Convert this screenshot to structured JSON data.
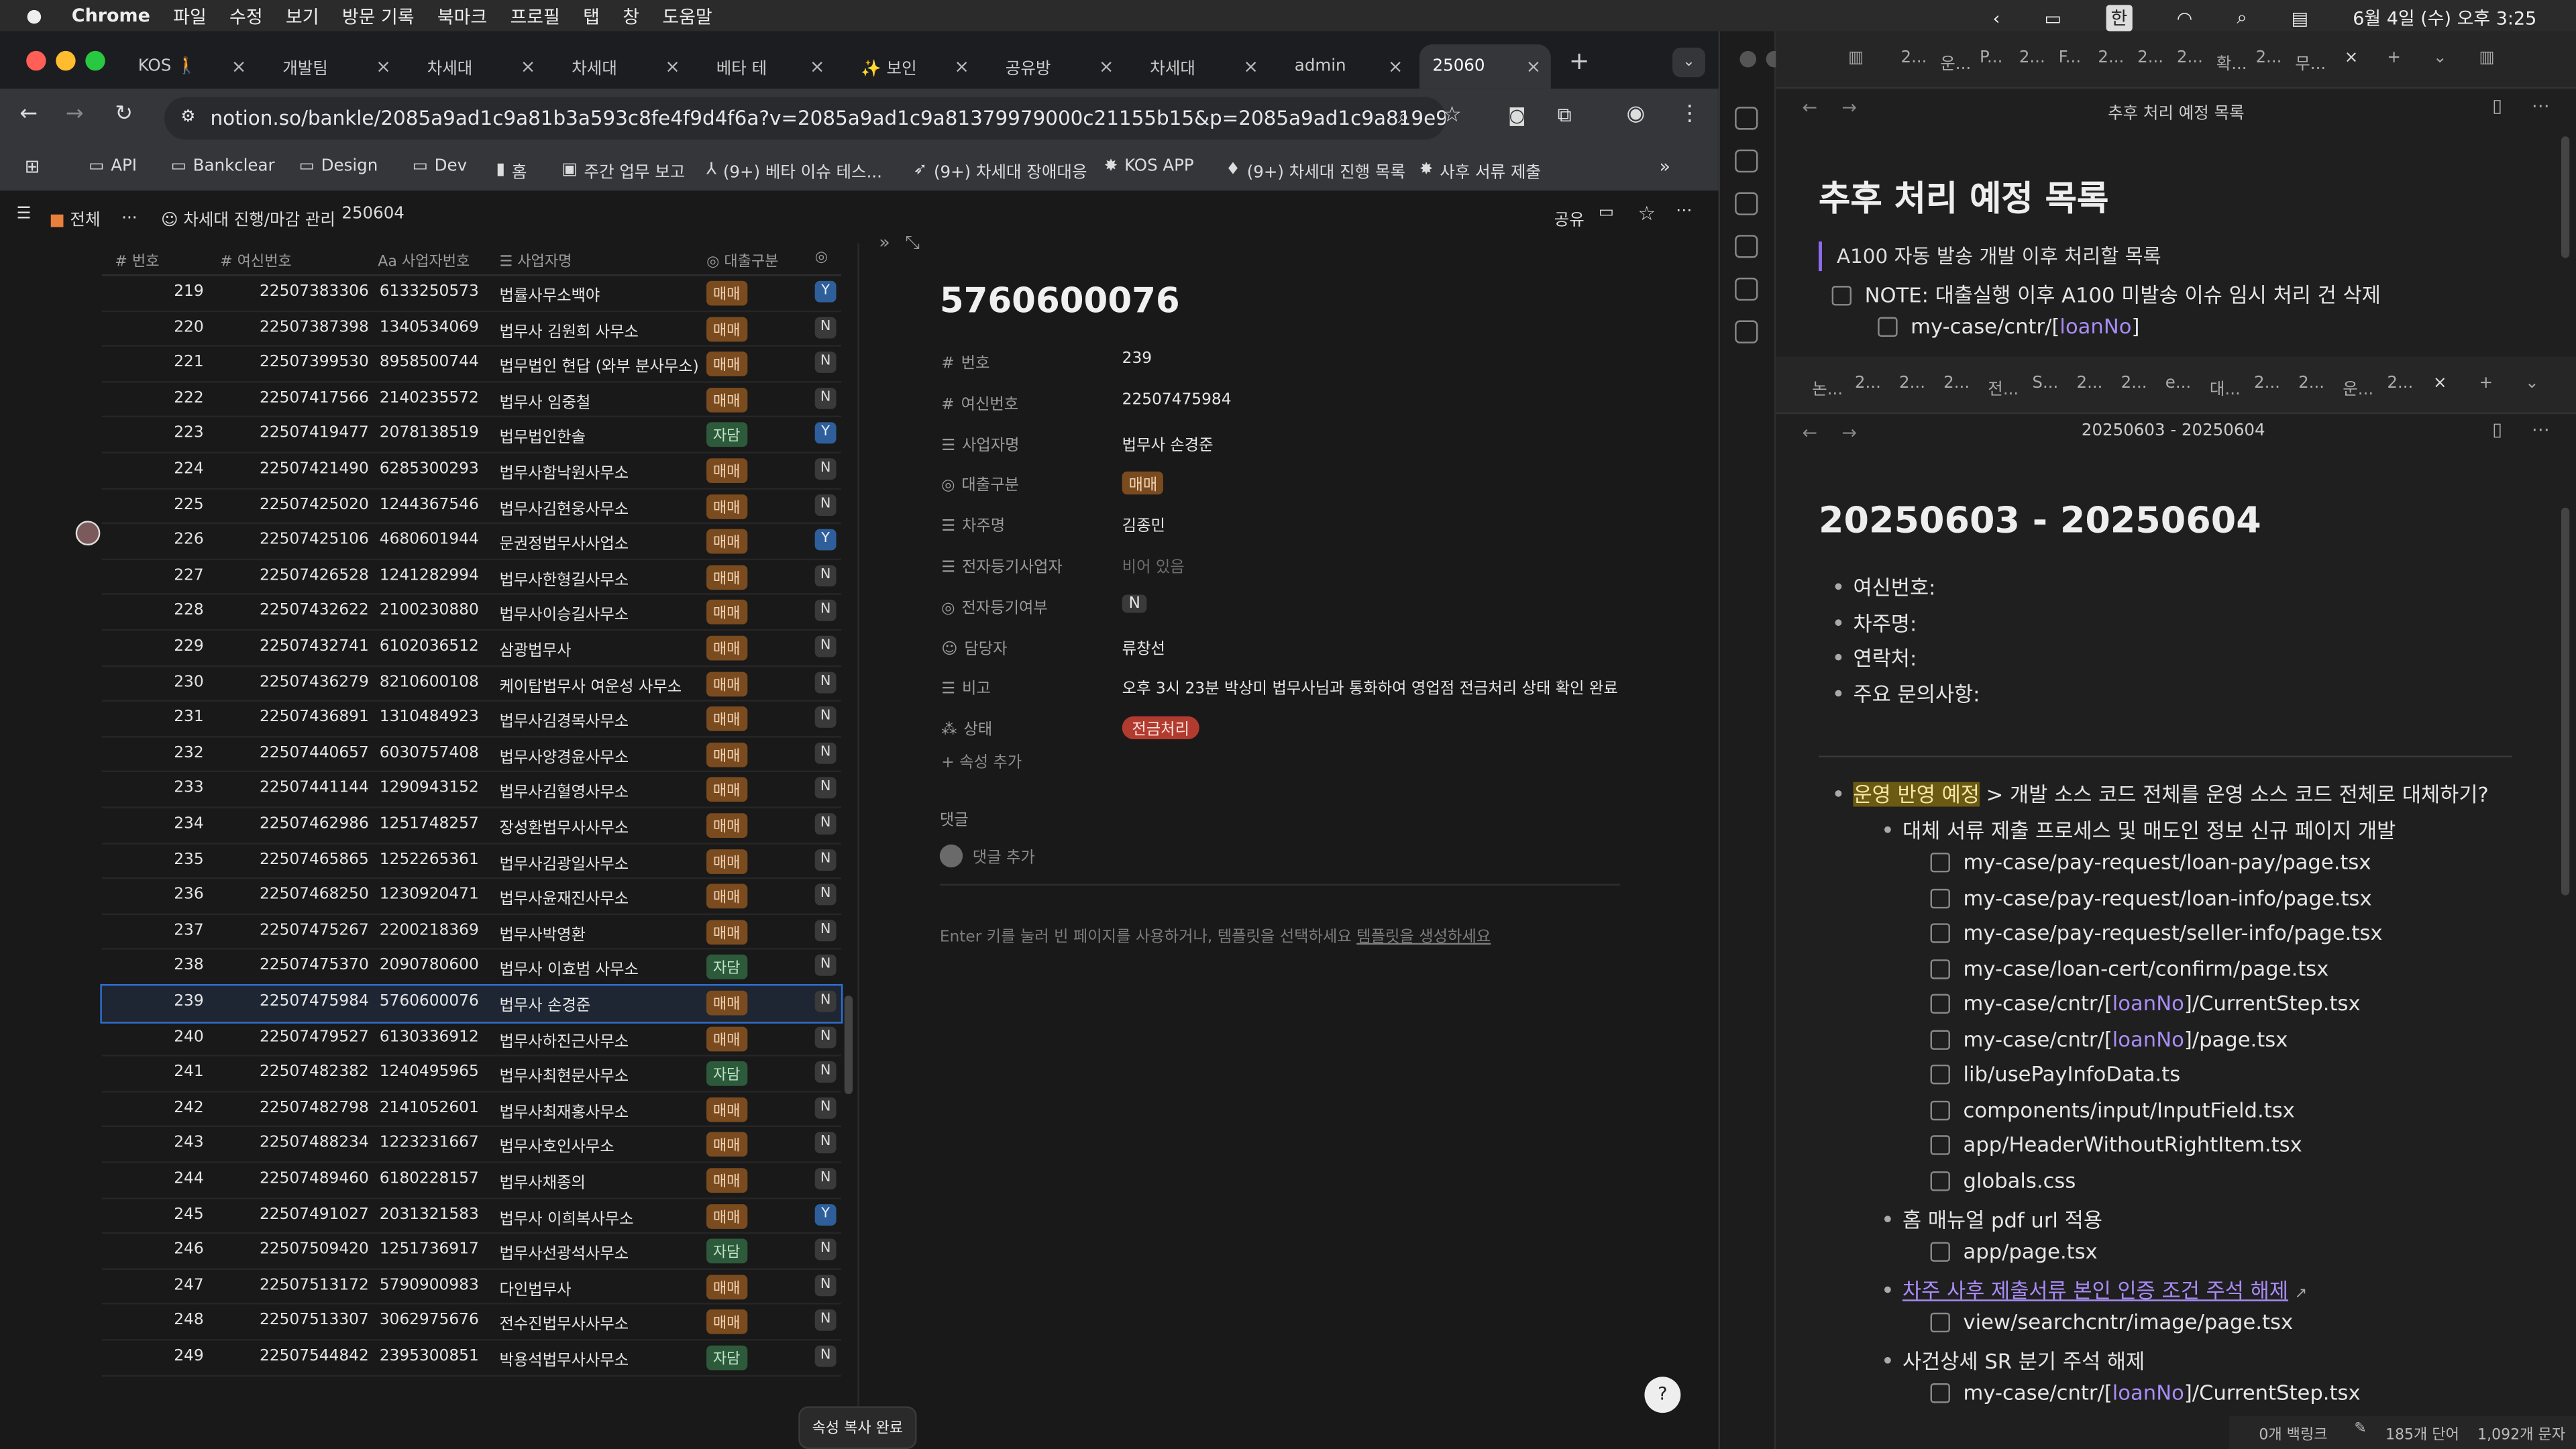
{
  "menubar": {
    "items": [
      "Chrome",
      "파일",
      "수정",
      "보기",
      "방문 기록",
      "북마크",
      "프로필",
      "탭",
      "창",
      "도움말"
    ],
    "datetime": "6월 4일 (수) 오후 3:25",
    "ime": "한"
  },
  "tabs": [
    {
      "label": "KOS 🚶"
    },
    {
      "label": "개발팀"
    },
    {
      "label": "차세대"
    },
    {
      "label": "차세대"
    },
    {
      "label": "베타 테"
    },
    {
      "label": "✨ 보인"
    },
    {
      "label": "공유방"
    },
    {
      "label": "차세대"
    },
    {
      "label": "admin"
    },
    {
      "label": "25060"
    }
  ],
  "url": "notion.so/bankle/2085a9ad1c9a81b3a593c8fe4f9d4f6a?v=2085a9ad1c9a81379979000c21155b15&p=2085a9ad1c9a819e9a59e...",
  "bookmarks": [
    "API",
    "Bankclear",
    "Design",
    "Dev",
    "홈",
    "주간 업무 보고",
    "(9+) 베타 이슈 테스...",
    "(9+) 차세대 장애대응",
    "KOS APP",
    "(9+) 차세대 진행 목록",
    "사후 서류 제출"
  ],
  "breadcrumb": {
    "items": [
      "전체",
      "...",
      "차세대 진행/마감 관리",
      "250604"
    ],
    "share": "공유"
  },
  "table": {
    "headers": [
      "번호",
      "여신번호",
      "사업자번호",
      "사업자명",
      "대출구분"
    ],
    "rows": [
      {
        "n": "219",
        "loan": "22507383306",
        "biz": "6133250573",
        "name": "법률사무소백야",
        "type": "매매",
        "flag": "Y"
      },
      {
        "n": "220",
        "loan": "22507387398",
        "biz": "1340534069",
        "name": "법무사 김원희 사무소",
        "type": "매매",
        "flag": "N"
      },
      {
        "n": "221",
        "loan": "22507399530",
        "biz": "8958500744",
        "name": "법무법인 현답 (와부 분사무소)",
        "type": "매매",
        "flag": "N"
      },
      {
        "n": "222",
        "loan": "22507417566",
        "biz": "2140235572",
        "name": "법무사 임중철",
        "type": "매매",
        "flag": "N"
      },
      {
        "n": "223",
        "loan": "22507419477",
        "biz": "2078138519",
        "name": "법무법인한솔",
        "type": "자담",
        "flag": "Y"
      },
      {
        "n": "224",
        "loan": "22507421490",
        "biz": "6285300293",
        "name": "법무사함낙원사무소",
        "type": "매매",
        "flag": "N"
      },
      {
        "n": "225",
        "loan": "22507425020",
        "biz": "1244367546",
        "name": "법무사김현웅사무소",
        "type": "매매",
        "flag": "N"
      },
      {
        "n": "226",
        "loan": "22507425106",
        "biz": "4680601944",
        "name": "문권정법무사사업소",
        "type": "매매",
        "flag": "Y"
      },
      {
        "n": "227",
        "loan": "22507426528",
        "biz": "1241282994",
        "name": "법무사한형길사무소",
        "type": "매매",
        "flag": "N"
      },
      {
        "n": "228",
        "loan": "22507432622",
        "biz": "2100230880",
        "name": "법무사이승길사무소",
        "type": "매매",
        "flag": "N"
      },
      {
        "n": "229",
        "loan": "22507432741",
        "biz": "6102036512",
        "name": "삼광법무사",
        "type": "매매",
        "flag": "N"
      },
      {
        "n": "230",
        "loan": "22507436279",
        "biz": "8210600108",
        "name": "케이탑법무사 여운성 사무소",
        "type": "매매",
        "flag": "N"
      },
      {
        "n": "231",
        "loan": "22507436891",
        "biz": "1310484923",
        "name": "법무사김경목사무소",
        "type": "매매",
        "flag": "N"
      },
      {
        "n": "232",
        "loan": "22507440657",
        "biz": "6030757408",
        "name": "법무사양경윤사무소",
        "type": "매매",
        "flag": "N"
      },
      {
        "n": "233",
        "loan": "22507441144",
        "biz": "1290943152",
        "name": "법무사김혈영사무소",
        "type": "매매",
        "flag": "N"
      },
      {
        "n": "234",
        "loan": "22507462986",
        "biz": "1251748257",
        "name": "장성환법무사사무소",
        "type": "매매",
        "flag": "N"
      },
      {
        "n": "235",
        "loan": "22507465865",
        "biz": "1252265361",
        "name": "법무사김광일사무소",
        "type": "매매",
        "flag": "N"
      },
      {
        "n": "236",
        "loan": "22507468250",
        "biz": "1230920471",
        "name": "법무사윤재진사무소",
        "type": "매매",
        "flag": "N"
      },
      {
        "n": "237",
        "loan": "22507475267",
        "biz": "2200218369",
        "name": "법무사박영환",
        "type": "매매",
        "flag": "N"
      },
      {
        "n": "238",
        "loan": "22507475370",
        "biz": "2090780600",
        "name": "법무사 이효범 사무소",
        "type": "자담",
        "flag": "N"
      },
      {
        "n": "239",
        "loan": "22507475984",
        "biz": "5760600076",
        "name": "법무사 손경준",
        "type": "매매",
        "flag": "N"
      },
      {
        "n": "240",
        "loan": "22507479527",
        "biz": "6130336912",
        "name": "법무사하진근사무소",
        "type": "매매",
        "flag": "N"
      },
      {
        "n": "241",
        "loan": "22507482382",
        "biz": "1240495965",
        "name": "법무사최현문사무소",
        "type": "자담",
        "flag": "N"
      },
      {
        "n": "242",
        "loan": "22507482798",
        "biz": "2141052601",
        "name": "법무사최재홍사무소",
        "type": "매매",
        "flag": "N"
      },
      {
        "n": "243",
        "loan": "22507488234",
        "biz": "1223231667",
        "name": "법무사호인사무소",
        "type": "매매",
        "flag": "N"
      },
      {
        "n": "244",
        "loan": "22507489460",
        "biz": "6180228157",
        "name": "법무사채종의",
        "type": "매매",
        "flag": "N"
      },
      {
        "n": "245",
        "loan": "22507491027",
        "biz": "2031321583",
        "name": "법무사 이희복사무소",
        "type": "매매",
        "flag": "Y"
      },
      {
        "n": "246",
        "loan": "22507509420",
        "biz": "1251736917",
        "name": "법무사선광석사무소",
        "type": "자담",
        "flag": "N"
      },
      {
        "n": "247",
        "loan": "22507513172",
        "biz": "5790900983",
        "name": "다인법무사",
        "type": "매매",
        "flag": "N"
      },
      {
        "n": "248",
        "loan": "22507513307",
        "biz": "3062975676",
        "name": "전수진법무사사무소",
        "type": "매매",
        "flag": "N"
      },
      {
        "n": "249",
        "loan": "22507544842",
        "biz": "2395300851",
        "name": "박용석법무사사무소",
        "type": "자담",
        "flag": "N"
      }
    ]
  },
  "detail": {
    "title": "5760600076",
    "props": [
      {
        "k": "번호",
        "v": "239"
      },
      {
        "k": "여신번호",
        "v": "22507475984"
      },
      {
        "k": "사업자명",
        "v": "법무사 손경준"
      },
      {
        "k": "대출구분",
        "v": "매매"
      },
      {
        "k": "차주명",
        "v": "김종민"
      },
      {
        "k": "전자등기사업자",
        "v": "비어 있음"
      },
      {
        "k": "전자등기여부",
        "v": "N"
      },
      {
        "k": "담당자",
        "v": "류창선"
      },
      {
        "k": "비고",
        "v": "오후 3시 23분 박상미 법무사님과 통화하여 영업점 전금처리 상태 확인 완료"
      },
      {
        "k": "상태",
        "v": "전금처리"
      }
    ],
    "add_prop": "속성 추가",
    "comments": "댓글",
    "add_comment": "댓글 추가",
    "empty_hint": "Enter 키를 눌러 빈 페이지를 사용하거나, 템플릿을 선택하세요",
    "template_link": "템플릿을 생성하세요",
    "toast": "속성 복사 완료"
  },
  "right": {
    "tabs": [
      "2...",
      "운...",
      "P...",
      "2...",
      "F...",
      "2...",
      "2...",
      "2...",
      "확...",
      "2...",
      "무..."
    ],
    "top_title": "추후 처리 예정 목록",
    "top_h1": "추후 처리 예정 목록",
    "top_quote": "A100 자동 발송 개발 이후 처리할 목록",
    "top_note": "NOTE: 대출실행 이후 A100 미발송 이슈 임시 처리 건 삭제",
    "top_item_pre": "my-case/cntr/[",
    "top_item_link": "loanNo",
    "top_item_post": "]",
    "tabs2": [
      "논...",
      "2...",
      "2...",
      "2...",
      "전...",
      "S...",
      "2...",
      "2...",
      "e...",
      "대...",
      "2...",
      "2...",
      "운...",
      "2..."
    ],
    "doc_title": "20250603 - 20250604",
    "doc_h1": "20250603 - 20250604",
    "fields": [
      "여신번호:",
      "차주명:",
      "연락처:",
      "주요 문의사항:"
    ],
    "main_highlight": "운영 반영 예정",
    "main_rest": " > 개발 소스 코드 전체를 운영 소스 코드 전체로 대체하기?",
    "sub1": "대체 서류 제출 프로세스 및 매도인 정보 신규 페이지 개발",
    "files1": [
      "my-case/pay-request/loan-pay/page.tsx",
      "my-case/pay-request/loan-info/page.tsx",
      "my-case/pay-request/seller-info/page.tsx",
      "my-case/loan-cert/confirm/page.tsx"
    ],
    "file_cntr_step": {
      "pre": "my-case/cntr/[",
      "link": "loanNo",
      "post": "]/CurrentStep.tsx"
    },
    "file_cntr_page": {
      "pre": "my-case/cntr/[",
      "link": "loanNo",
      "post": "]/page.tsx"
    },
    "files2": [
      "lib/usePayInfoData.ts",
      "components/input/InputField.tsx",
      "app/HeaderWithoutRightItem.tsx",
      "globals.css"
    ],
    "sub2": "홈 매뉴얼 pdf url 적용",
    "file_app": "app/page.tsx",
    "sub3": "차주 사후 제출서류 본인 인증 조건 주석 해제",
    "file_view": "view/searchcntr/image/page.tsx",
    "sub4": "사건상세 SR 분기 주석 해제",
    "file_last": {
      "pre": "my-case/cntr/[",
      "link": "loanNo",
      "post": "]/CurrentStep.tsx"
    },
    "status": {
      "backlinks": "0개 백링크",
      "words": "185개 단어",
      "chars": "1,092개 문자"
    }
  },
  "colors": {
    "brand_tag_maemae": "#7a4b1f",
    "brand_tag_jadam": "#2d5a3a",
    "flag_y": "#2f5f9b",
    "status_red": "#b23b2f",
    "link": "#a98cf5"
  }
}
